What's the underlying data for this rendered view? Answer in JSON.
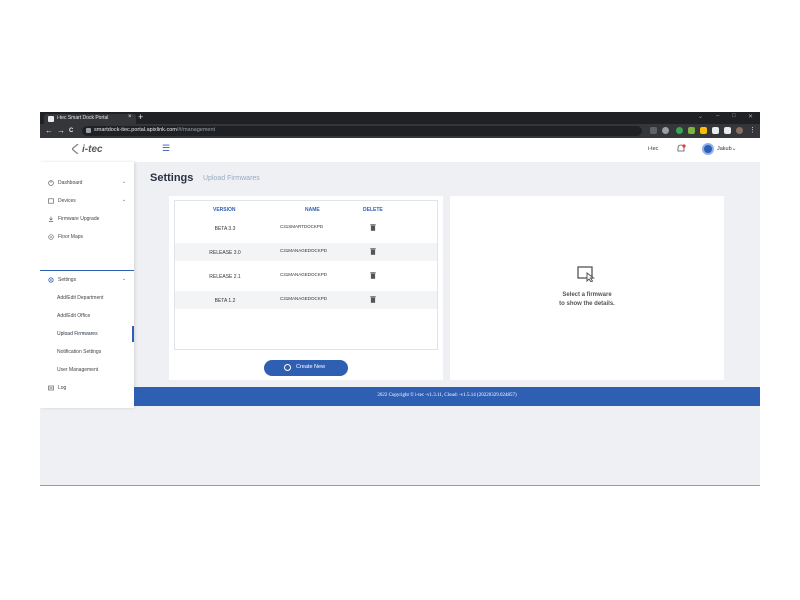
{
  "browser": {
    "tab_title": "i-tec Smart Dock Portal",
    "tab_close": "×",
    "new_tab": "+",
    "url_host": "smartdock-itec.portal.apixlink.com",
    "url_path": "/#/management",
    "back": "←",
    "forward": "→",
    "reload": "C"
  },
  "header": {
    "logo_text": "i-tec",
    "menu_icon": "☰",
    "company": "i-tec",
    "user": "Jakub",
    "user_chevron": "⌄"
  },
  "sidebar": {
    "items": [
      {
        "label": "Dashboard",
        "icon": "dashboard-icon",
        "chevron": "⌄"
      },
      {
        "label": "Devices",
        "icon": "devices-icon",
        "chevron": "⌄"
      },
      {
        "label": "Firmware Upgrade",
        "icon": "firmware-icon"
      },
      {
        "label": "Floor Maps",
        "icon": "map-pin-icon"
      }
    ],
    "settings": {
      "label": "Settings",
      "icon": "gear-icon",
      "chevron": "⌄"
    },
    "sub_items": [
      {
        "label": "Add/Edit Department"
      },
      {
        "label": "Add/Edit Office"
      },
      {
        "label": "Upload Firmwares",
        "active": true
      },
      {
        "label": "Notification Settings"
      },
      {
        "label": "User Management"
      }
    ],
    "log": {
      "label": "Log",
      "icon": "log-icon"
    }
  },
  "main": {
    "title": "Settings",
    "subtitle": "Upload Firmwares",
    "table": {
      "headers": {
        "version": "VERSION",
        "name": "NAME",
        "delete": "DELETE"
      },
      "rows": [
        {
          "version": "BETA 3.3",
          "name": "C31SMARTDOCKPD"
        },
        {
          "version": "RELEASE 3.0",
          "name": "C31MANAGEDOCKPD"
        },
        {
          "version": "RELEASE 2.1",
          "name": "C31MANAGEDOCKPD"
        },
        {
          "version": "BETA 1.2",
          "name": "C31MANAGEDOCKPD"
        }
      ]
    },
    "create_button": "Create New",
    "details": {
      "line1": "Select a firmware",
      "line2": "to show the details."
    }
  },
  "footer": {
    "text": "2022 Copyright © i-tec -v1.3.11, Cloud: -v1.5.14 (20220329.024857)"
  },
  "colors": {
    "accent": "#2f5fb3",
    "background": "#eef0f4"
  }
}
